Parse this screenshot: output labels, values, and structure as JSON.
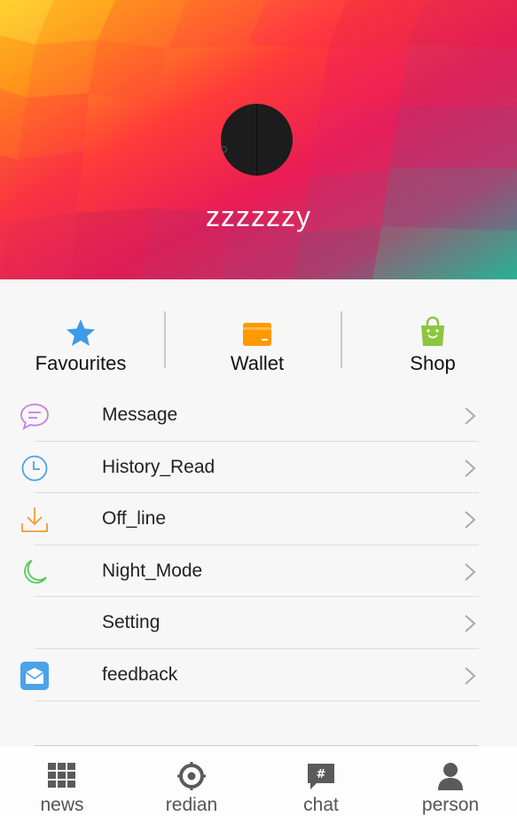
{
  "profile": {
    "username": "zzzzzzy"
  },
  "quick_actions": [
    {
      "label": "Favourites",
      "icon": "star-icon",
      "color": "#3d9be9"
    },
    {
      "label": "Wallet",
      "icon": "wallet-icon",
      "color": "#ff9900"
    },
    {
      "label": "Shop",
      "icon": "shopping-bag-icon",
      "color": "#8cc63e"
    }
  ],
  "menu": [
    {
      "label": "Message",
      "icon": "chat-bubble-icon",
      "color": "#c77ee8"
    },
    {
      "label": "History_Read",
      "icon": "clock-icon",
      "color": "#4aa3e8"
    },
    {
      "label": "Off_line",
      "icon": "download-icon",
      "color": "#f29a3c"
    },
    {
      "label": "Night_Mode",
      "icon": "moon-icon",
      "color": "#59c85a"
    },
    {
      "label": "Setting",
      "icon": "",
      "color": ""
    },
    {
      "label": "feedback",
      "icon": "feedback-mail-icon",
      "color": "#4aa3e8"
    }
  ],
  "tabs": [
    {
      "label": "news",
      "icon": "grid-icon"
    },
    {
      "label": "redian",
      "icon": "target-icon"
    },
    {
      "label": "chat",
      "icon": "hash-bubble-icon"
    },
    {
      "label": "person",
      "icon": "person-icon"
    }
  ]
}
